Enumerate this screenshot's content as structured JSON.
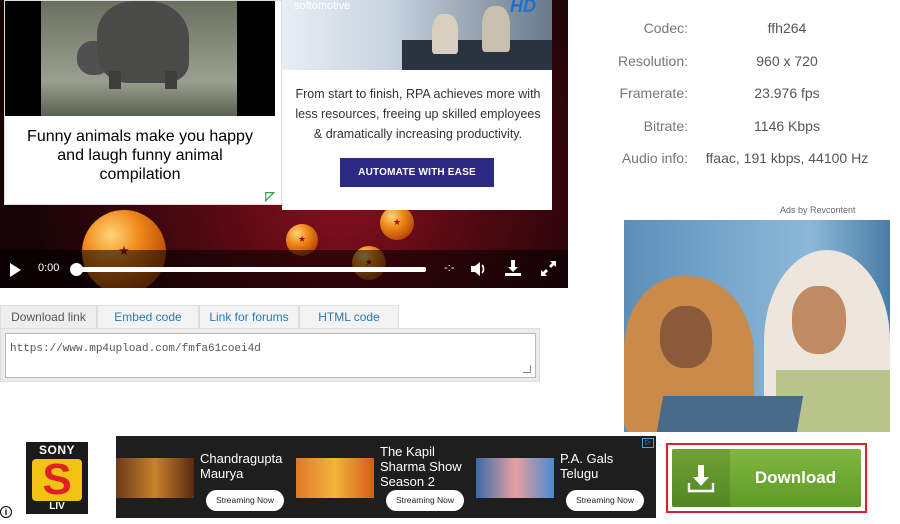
{
  "player": {
    "ad_left": {
      "caption": "Funny animals make you happy and laugh funny animal compilation"
    },
    "ad_right": {
      "brand": "softomotive",
      "badge": "HD",
      "body": "From start to finish, RPA achieves more with less resources, freeing up skilled employees & dramatically increasing productivity.",
      "cta": "AUTOMATE WITH EASE"
    },
    "controls": {
      "current_time": "0:00",
      "remaining_time": "-:-",
      "progress": 0
    }
  },
  "info": {
    "rows": [
      {
        "label": "Codec:",
        "value": "ffh264"
      },
      {
        "label": "Resolution:",
        "value": "960 x 720"
      },
      {
        "label": "Framerate:",
        "value": "23.976 fps"
      },
      {
        "label": "Bitrate:",
        "value": "1146 Kbps"
      },
      {
        "label": "Audio info:",
        "value": "ffaac, 191 kbps, 44100 Hz"
      }
    ],
    "ads_by": "Ads by Revcontent"
  },
  "tabs": {
    "items": [
      {
        "label": "Download link",
        "active": true
      },
      {
        "label": "Embed code",
        "active": false
      },
      {
        "label": "Link for forums",
        "active": false
      },
      {
        "label": "HTML code",
        "active": false
      }
    ],
    "code_value": "https://www.mp4upload.com/fmfa61coei4d"
  },
  "banner": {
    "brand_top": "SONY",
    "brand_bottom": "LIV",
    "shows": [
      {
        "title": "Chandragupta Maurya",
        "cta": "Streaming Now"
      },
      {
        "title": "The Kapil Sharma Show Season 2",
        "cta": "Streaming Now"
      },
      {
        "title": "P.A. Gals Telugu",
        "cta": "Streaming Now"
      }
    ]
  },
  "download": {
    "label": "Download"
  },
  "colors": {
    "accent_link": "#2a7ab5",
    "download_green": "#6aa82f",
    "highlight_red": "#e01f26",
    "cta_navy": "#2c2a85"
  }
}
